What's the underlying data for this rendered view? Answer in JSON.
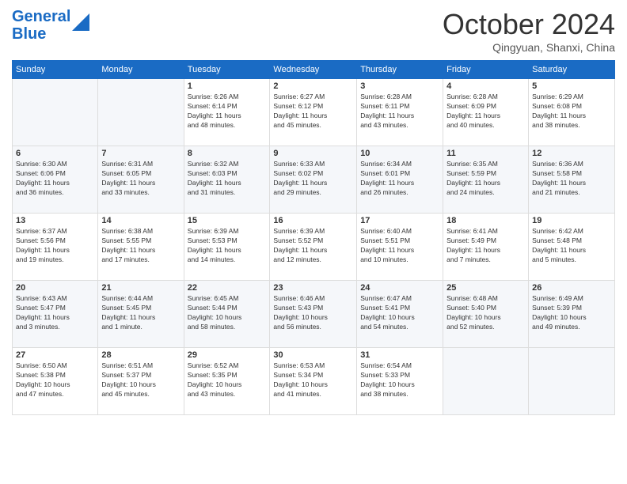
{
  "header": {
    "title": "October 2024",
    "subtitle": "Qingyuan, Shanxi, China"
  },
  "columns": [
    "Sunday",
    "Monday",
    "Tuesday",
    "Wednesday",
    "Thursday",
    "Friday",
    "Saturday"
  ],
  "weeks": [
    [
      {
        "day": "",
        "info": ""
      },
      {
        "day": "",
        "info": ""
      },
      {
        "day": "1",
        "info": "Sunrise: 6:26 AM\nSunset: 6:14 PM\nDaylight: 11 hours\nand 48 minutes."
      },
      {
        "day": "2",
        "info": "Sunrise: 6:27 AM\nSunset: 6:12 PM\nDaylight: 11 hours\nand 45 minutes."
      },
      {
        "day": "3",
        "info": "Sunrise: 6:28 AM\nSunset: 6:11 PM\nDaylight: 11 hours\nand 43 minutes."
      },
      {
        "day": "4",
        "info": "Sunrise: 6:28 AM\nSunset: 6:09 PM\nDaylight: 11 hours\nand 40 minutes."
      },
      {
        "day": "5",
        "info": "Sunrise: 6:29 AM\nSunset: 6:08 PM\nDaylight: 11 hours\nand 38 minutes."
      }
    ],
    [
      {
        "day": "6",
        "info": "Sunrise: 6:30 AM\nSunset: 6:06 PM\nDaylight: 11 hours\nand 36 minutes."
      },
      {
        "day": "7",
        "info": "Sunrise: 6:31 AM\nSunset: 6:05 PM\nDaylight: 11 hours\nand 33 minutes."
      },
      {
        "day": "8",
        "info": "Sunrise: 6:32 AM\nSunset: 6:03 PM\nDaylight: 11 hours\nand 31 minutes."
      },
      {
        "day": "9",
        "info": "Sunrise: 6:33 AM\nSunset: 6:02 PM\nDaylight: 11 hours\nand 29 minutes."
      },
      {
        "day": "10",
        "info": "Sunrise: 6:34 AM\nSunset: 6:01 PM\nDaylight: 11 hours\nand 26 minutes."
      },
      {
        "day": "11",
        "info": "Sunrise: 6:35 AM\nSunset: 5:59 PM\nDaylight: 11 hours\nand 24 minutes."
      },
      {
        "day": "12",
        "info": "Sunrise: 6:36 AM\nSunset: 5:58 PM\nDaylight: 11 hours\nand 21 minutes."
      }
    ],
    [
      {
        "day": "13",
        "info": "Sunrise: 6:37 AM\nSunset: 5:56 PM\nDaylight: 11 hours\nand 19 minutes."
      },
      {
        "day": "14",
        "info": "Sunrise: 6:38 AM\nSunset: 5:55 PM\nDaylight: 11 hours\nand 17 minutes."
      },
      {
        "day": "15",
        "info": "Sunrise: 6:39 AM\nSunset: 5:53 PM\nDaylight: 11 hours\nand 14 minutes."
      },
      {
        "day": "16",
        "info": "Sunrise: 6:39 AM\nSunset: 5:52 PM\nDaylight: 11 hours\nand 12 minutes."
      },
      {
        "day": "17",
        "info": "Sunrise: 6:40 AM\nSunset: 5:51 PM\nDaylight: 11 hours\nand 10 minutes."
      },
      {
        "day": "18",
        "info": "Sunrise: 6:41 AM\nSunset: 5:49 PM\nDaylight: 11 hours\nand 7 minutes."
      },
      {
        "day": "19",
        "info": "Sunrise: 6:42 AM\nSunset: 5:48 PM\nDaylight: 11 hours\nand 5 minutes."
      }
    ],
    [
      {
        "day": "20",
        "info": "Sunrise: 6:43 AM\nSunset: 5:47 PM\nDaylight: 11 hours\nand 3 minutes."
      },
      {
        "day": "21",
        "info": "Sunrise: 6:44 AM\nSunset: 5:45 PM\nDaylight: 11 hours\nand 1 minute."
      },
      {
        "day": "22",
        "info": "Sunrise: 6:45 AM\nSunset: 5:44 PM\nDaylight: 10 hours\nand 58 minutes."
      },
      {
        "day": "23",
        "info": "Sunrise: 6:46 AM\nSunset: 5:43 PM\nDaylight: 10 hours\nand 56 minutes."
      },
      {
        "day": "24",
        "info": "Sunrise: 6:47 AM\nSunset: 5:41 PM\nDaylight: 10 hours\nand 54 minutes."
      },
      {
        "day": "25",
        "info": "Sunrise: 6:48 AM\nSunset: 5:40 PM\nDaylight: 10 hours\nand 52 minutes."
      },
      {
        "day": "26",
        "info": "Sunrise: 6:49 AM\nSunset: 5:39 PM\nDaylight: 10 hours\nand 49 minutes."
      }
    ],
    [
      {
        "day": "27",
        "info": "Sunrise: 6:50 AM\nSunset: 5:38 PM\nDaylight: 10 hours\nand 47 minutes."
      },
      {
        "day": "28",
        "info": "Sunrise: 6:51 AM\nSunset: 5:37 PM\nDaylight: 10 hours\nand 45 minutes."
      },
      {
        "day": "29",
        "info": "Sunrise: 6:52 AM\nSunset: 5:35 PM\nDaylight: 10 hours\nand 43 minutes."
      },
      {
        "day": "30",
        "info": "Sunrise: 6:53 AM\nSunset: 5:34 PM\nDaylight: 10 hours\nand 41 minutes."
      },
      {
        "day": "31",
        "info": "Sunrise: 6:54 AM\nSunset: 5:33 PM\nDaylight: 10 hours\nand 38 minutes."
      },
      {
        "day": "",
        "info": ""
      },
      {
        "day": "",
        "info": ""
      }
    ]
  ]
}
